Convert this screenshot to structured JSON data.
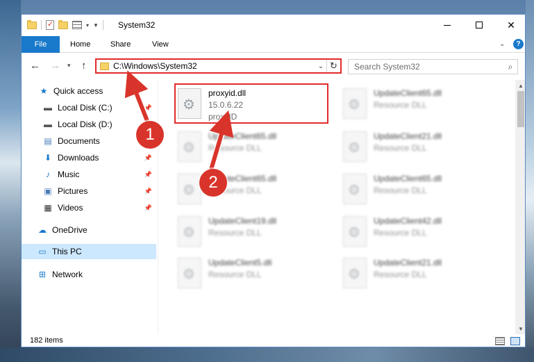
{
  "window": {
    "title": "System32",
    "close_label": "✕"
  },
  "ribbon": {
    "tabs": [
      {
        "label": "File"
      },
      {
        "label": "Home"
      },
      {
        "label": "Share"
      },
      {
        "label": "View"
      }
    ],
    "help_label": "?"
  },
  "navbar": {
    "address": "C:\\Windows\\System32",
    "search_placeholder": "Search System32"
  },
  "sidebar": {
    "items": [
      {
        "label": "Quick access",
        "icon": "star-icon",
        "pinned": false
      },
      {
        "label": "Local Disk (C:)",
        "icon": "drive-icon",
        "pinned": true
      },
      {
        "label": "Local Disk (D:)",
        "icon": "drive-icon",
        "pinned": false
      },
      {
        "label": "Documents",
        "icon": "document-icon",
        "pinned": true
      },
      {
        "label": "Downloads",
        "icon": "download-icon",
        "pinned": true
      },
      {
        "label": "Music",
        "icon": "music-icon",
        "pinned": true
      },
      {
        "label": "Pictures",
        "icon": "pictures-icon",
        "pinned": true
      },
      {
        "label": "Videos",
        "icon": "video-icon",
        "pinned": true
      },
      {
        "label": "OneDrive",
        "icon": "cloud-icon",
        "pinned": false
      },
      {
        "label": "This PC",
        "icon": "computer-icon",
        "pinned": false,
        "selected": true
      },
      {
        "label": "Network",
        "icon": "network-icon",
        "pinned": false
      }
    ]
  },
  "files": [
    {
      "name": "proxyid.dll",
      "version": "15.0.6.22",
      "desc": "proxyID",
      "highlighted": true
    },
    {
      "name": "UpdateClient65.dll",
      "desc": "Resource DLL"
    },
    {
      "name": "UpdateClient65.dll",
      "desc": "Resource DLL"
    },
    {
      "name": "UpdateClient21.dll",
      "desc": "Resource DLL"
    },
    {
      "name": "UpdateClient65.dll",
      "desc": "Resource DLL"
    },
    {
      "name": "UpdateClient65.dll",
      "desc": "Resource DLL"
    },
    {
      "name": "UpdateClient19.dll",
      "desc": "Resource DLL"
    },
    {
      "name": "UpdateClient42.dll",
      "desc": "Resource DLL"
    },
    {
      "name": "UpdateClient5.dll",
      "desc": "Resource DLL"
    },
    {
      "name": "UpdateClient21.dll",
      "desc": "Resource DLL"
    }
  ],
  "status": {
    "item_count": "182 items"
  },
  "annotations": {
    "badge1": "1",
    "badge2": "2",
    "accent_color": "#e22a2a"
  }
}
